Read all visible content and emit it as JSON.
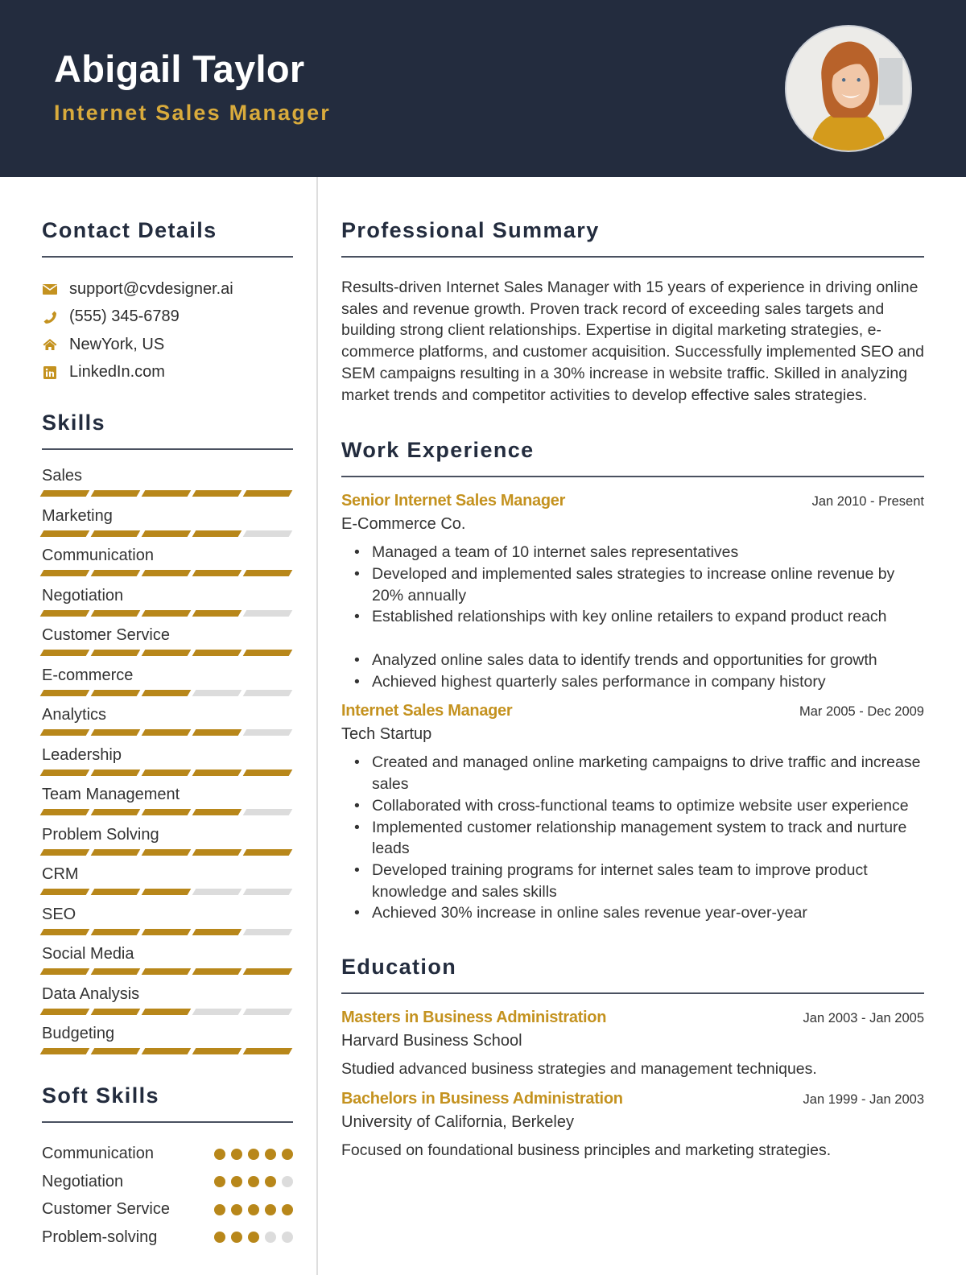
{
  "header": {
    "name": "Abigail Taylor",
    "title": "Internet Sales Manager",
    "photo_alt": "profile-photo"
  },
  "colors": {
    "header_bg": "#232c3e",
    "accent": "#b8871a",
    "title_gold": "#d9ab3c",
    "inactive": "#dcdcdc"
  },
  "contact": {
    "heading": "Contact Details",
    "items": [
      {
        "icon": "envelope-icon",
        "text": "support@cvdesigner.ai"
      },
      {
        "icon": "phone-icon",
        "text": "(555) 345-6789"
      },
      {
        "icon": "home-icon",
        "text": "NewYork, US"
      },
      {
        "icon": "linkedin-icon",
        "text": "LinkedIn.com"
      }
    ]
  },
  "skills": {
    "heading": "Skills",
    "max": 5,
    "items": [
      {
        "name": "Sales",
        "level": 5
      },
      {
        "name": "Marketing",
        "level": 4
      },
      {
        "name": "Communication",
        "level": 5
      },
      {
        "name": "Negotiation",
        "level": 4
      },
      {
        "name": "Customer Service",
        "level": 5
      },
      {
        "name": "E-commerce",
        "level": 3
      },
      {
        "name": "Analytics",
        "level": 4
      },
      {
        "name": "Leadership",
        "level": 5
      },
      {
        "name": "Team Management",
        "level": 4
      },
      {
        "name": "Problem Solving",
        "level": 5
      },
      {
        "name": "CRM",
        "level": 3
      },
      {
        "name": "SEO",
        "level": 4
      },
      {
        "name": "Social Media",
        "level": 5
      },
      {
        "name": "Data Analysis",
        "level": 3
      },
      {
        "name": "Budgeting",
        "level": 5
      }
    ]
  },
  "soft_skills": {
    "heading": "Soft Skills",
    "max": 5,
    "items": [
      {
        "name": "Communication",
        "level": 5
      },
      {
        "name": "Negotiation",
        "level": 4
      },
      {
        "name": "Customer Service",
        "level": 5
      },
      {
        "name": "Problem-solving",
        "level": 3
      }
    ]
  },
  "summary": {
    "heading": "Professional Summary",
    "text": "Results-driven Internet Sales Manager with 15 years of experience in driving online sales and revenue growth. Proven track record of exceeding sales targets and building strong client relationships. Expertise in digital marketing strategies, e-commerce platforms, and customer acquisition. Successfully implemented SEO and SEM campaigns resulting in a 30% increase in website traffic. Skilled in analyzing market trends and competitor activities to develop effective sales strategies."
  },
  "experience": {
    "heading": "Work Experience",
    "jobs": [
      {
        "role": "Senior Internet Sales Manager",
        "dates": "Jan 2010 - Present",
        "company": "E-Commerce Co.",
        "bullets": [
          "Managed a team of 10 internet sales representatives",
          "Developed and implemented sales strategies to increase online revenue by 20% annually",
          "Established relationships with key online retailers to expand product reach",
          "Analyzed online sales data to identify trends and opportunities for growth",
          "Achieved highest quarterly sales performance in company history"
        ]
      },
      {
        "role": "Internet Sales Manager",
        "dates": "Mar 2005 - Dec 2009",
        "company": "Tech Startup",
        "bullets": [
          "Created and managed online marketing campaigns to drive traffic and increase sales",
          "Collaborated with cross-functional teams to optimize website user experience",
          "Implemented customer relationship management system to track and nurture leads",
          "Developed training programs for internet sales team to improve product knowledge and sales skills",
          "Achieved 30% increase in online sales revenue year-over-year"
        ]
      }
    ]
  },
  "education": {
    "heading": "Education",
    "items": [
      {
        "degree": "Masters in Business Administration",
        "dates": "Jan 2003 - Jan 2005",
        "school": "Harvard Business School",
        "description": "Studied advanced business strategies and management techniques."
      },
      {
        "degree": "Bachelors in Business Administration",
        "dates": "Jan 1999 - Jan 2003",
        "school": "University of California, Berkeley",
        "description": "Focused on foundational business principles and marketing strategies."
      }
    ]
  }
}
